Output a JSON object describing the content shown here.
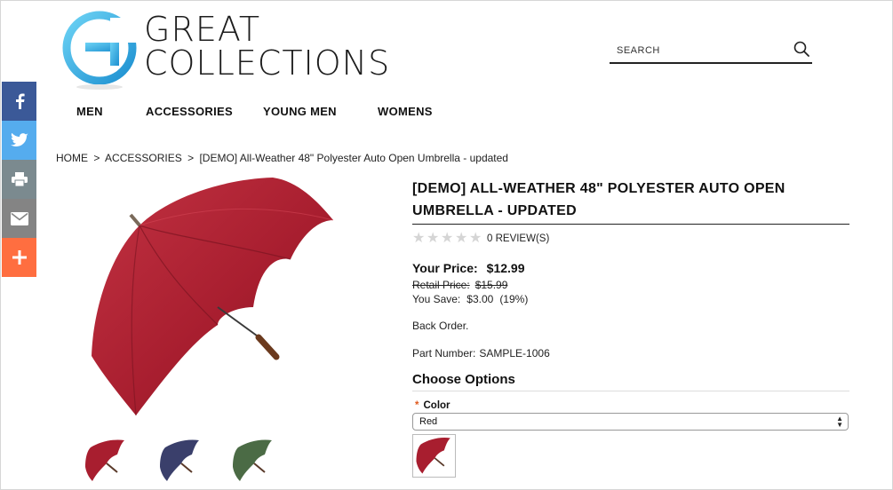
{
  "logo": {
    "line1": "GREAT",
    "line2": "COLLECTIONS"
  },
  "search": {
    "placeholder": "SEARCH"
  },
  "nav": [
    "MEN",
    "ACCESSORIES",
    "YOUNG MEN",
    "WOMENS"
  ],
  "social": [
    "facebook-icon",
    "twitter-icon",
    "print-icon",
    "email-icon",
    "plus-icon"
  ],
  "breadcrumb": {
    "home": "HOME",
    "sep1": ">",
    "cat": "ACCESSORIES",
    "sep2": ">",
    "current": "[DEMO] All-Weather 48\" Polyester Auto Open Umbrella - updated"
  },
  "product": {
    "title": "[DEMO] ALL-WEATHER 48\" POLYESTER AUTO OPEN UMBRELLA - UPDATED",
    "stars": [
      "★",
      "★",
      "★",
      "★",
      "★"
    ],
    "rating_value": 0,
    "reviews": "0 REVIEW(S)",
    "price_label": "Your Price:",
    "price": "$12.99",
    "retail_label": "Retail Price:",
    "retail": "$15.99",
    "save_label": "You Save:",
    "save_amount": "$3.00",
    "save_pct": "(19%)",
    "stock": "Back Order.",
    "part_label": "Part Number:",
    "part_number": "SAMPLE-1006",
    "options_title": "Choose Options",
    "option_required": "*",
    "option_label": "Color",
    "option_selected": "Red"
  },
  "colors": {
    "red": "#a81e2f",
    "navy": "#3a3f6b",
    "green": "#4b6b45",
    "accent": "#3fa9dc"
  }
}
